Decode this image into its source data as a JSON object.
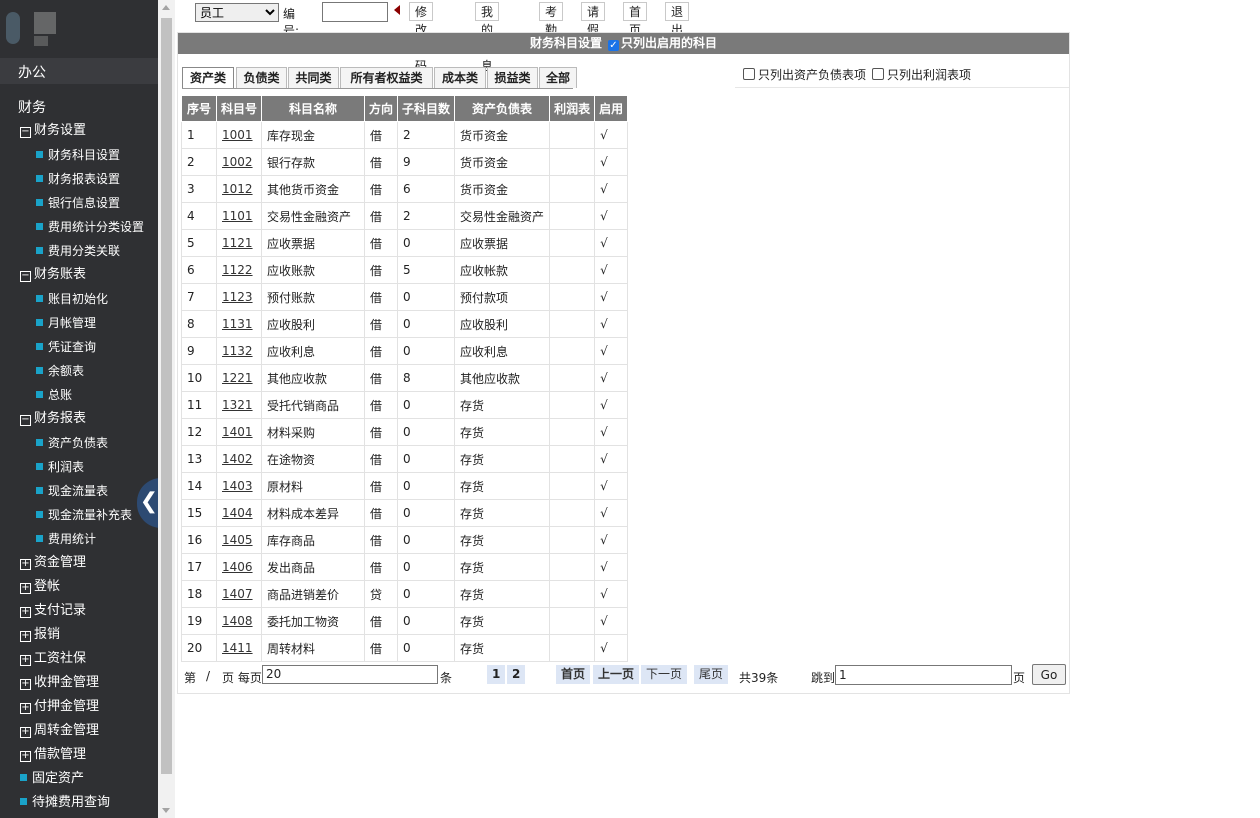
{
  "sidebar": {
    "sections": {
      "office": "办公",
      "finance": "财务"
    },
    "groups": [
      {
        "label": "财务设置",
        "expanded": true,
        "items": [
          "财务科目设置",
          "财务报表设置",
          "银行信息设置",
          "费用统计分类设置",
          "费用分类关联"
        ]
      },
      {
        "label": "财务账表",
        "expanded": true,
        "items": [
          "账目初始化",
          "月帐管理",
          "凭证查询",
          "余额表",
          "总账"
        ]
      },
      {
        "label": "财务报表",
        "expanded": true,
        "items": [
          "资产负债表",
          "利润表",
          "现金流量表",
          "现金流量补充表",
          "费用统计"
        ]
      }
    ],
    "collapsed_groups": [
      "资金管理",
      "登帐",
      "支付记录",
      "报销",
      "工资社保",
      "收押金管理",
      "付押金管理",
      "周转金管理",
      "借款管理"
    ],
    "leaf_groups": [
      "固定资产",
      "待摊费用查询"
    ],
    "collapse_icon": "chevron-left-icon"
  },
  "toolbar": {
    "role_select": "员工",
    "number_label": "编号:",
    "number_value": "",
    "buttons": [
      "修改密码",
      "我的信息",
      "考勤",
      "请假",
      "首页",
      "退出"
    ]
  },
  "panel": {
    "title": "财务科目设置",
    "only_enabled_label": "只列出启用的科目",
    "only_enabled_checked": true,
    "tabs": [
      "资产类",
      "负债类",
      "共同类",
      "所有者权益类",
      "成本类",
      "损益类",
      "全部"
    ],
    "active_tab": "资产类",
    "options": {
      "balance_only": "只列出资产负债表项",
      "profit_only": "只列出利润表项"
    }
  },
  "table": {
    "headers": [
      "序号",
      "科目号",
      "科目名称",
      "方向",
      "子科目数",
      "资产负债表",
      "利润表",
      "启用"
    ],
    "rows": [
      [
        "1",
        "1001",
        "库存现金",
        "借",
        "2",
        "货币资金",
        "",
        "√"
      ],
      [
        "2",
        "1002",
        "银行存款",
        "借",
        "9",
        "货币资金",
        "",
        "√"
      ],
      [
        "3",
        "1012",
        "其他货币资金",
        "借",
        "6",
        "货币资金",
        "",
        "√"
      ],
      [
        "4",
        "1101",
        "交易性金融资产",
        "借",
        "2",
        "交易性金融资产",
        "",
        "√"
      ],
      [
        "5",
        "1121",
        "应收票据",
        "借",
        "0",
        "应收票据",
        "",
        "√"
      ],
      [
        "6",
        "1122",
        "应收账款",
        "借",
        "5",
        "应收帐款",
        "",
        "√"
      ],
      [
        "7",
        "1123",
        "预付账款",
        "借",
        "0",
        "预付款项",
        "",
        "√"
      ],
      [
        "8",
        "1131",
        "应收股利",
        "借",
        "0",
        "应收股利",
        "",
        "√"
      ],
      [
        "9",
        "1132",
        "应收利息",
        "借",
        "0",
        "应收利息",
        "",
        "√"
      ],
      [
        "10",
        "1221",
        "其他应收款",
        "借",
        "8",
        "其他应收款",
        "",
        "√"
      ],
      [
        "11",
        "1321",
        "受托代销商品",
        "借",
        "0",
        "存货",
        "",
        "√"
      ],
      [
        "12",
        "1401",
        "材料采购",
        "借",
        "0",
        "存货",
        "",
        "√"
      ],
      [
        "13",
        "1402",
        "在途物资",
        "借",
        "0",
        "存货",
        "",
        "√"
      ],
      [
        "14",
        "1403",
        "原材料",
        "借",
        "0",
        "存货",
        "",
        "√"
      ],
      [
        "15",
        "1404",
        "材料成本差异",
        "借",
        "0",
        "存货",
        "",
        "√"
      ],
      [
        "16",
        "1405",
        "库存商品",
        "借",
        "0",
        "存货",
        "",
        "√"
      ],
      [
        "17",
        "1406",
        "发出商品",
        "借",
        "0",
        "存货",
        "",
        "√"
      ],
      [
        "18",
        "1407",
        "商品进销差价",
        "贷",
        "0",
        "存货",
        "",
        "√"
      ],
      [
        "19",
        "1408",
        "委托加工物资",
        "借",
        "0",
        "存货",
        "",
        "√"
      ],
      [
        "20",
        "1411",
        "周转材料",
        "借",
        "0",
        "存货",
        "",
        "√"
      ]
    ]
  },
  "pager": {
    "di": "第",
    "slash": "/",
    "ye_meiye": "页 每页",
    "page_size": "20",
    "tiao": "条",
    "pages": [
      "1",
      "2"
    ],
    "first": "首页",
    "prev": "上一页",
    "next": "下一页",
    "last": "尾页",
    "total_prefix": "共",
    "total": "39",
    "total_suffix": "条",
    "jump_label": "跳到",
    "jump_value": "1",
    "ye": "页",
    "go": "Go"
  },
  "colors": {
    "sidebar_bg": "#2f3033",
    "accent": "#1aa3c9",
    "header_bg": "#7a7a7a"
  }
}
